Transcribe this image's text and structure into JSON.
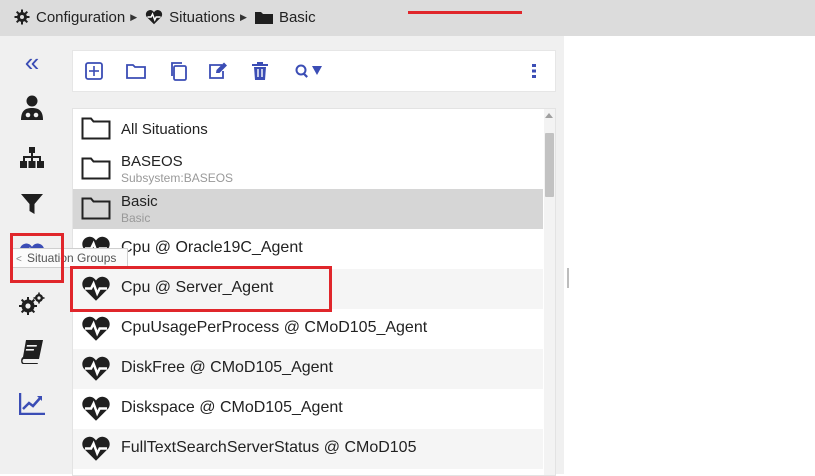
{
  "breadcrumb": {
    "items": [
      {
        "label": "Configuration",
        "icon": "gear-icon"
      },
      {
        "label": "Situations",
        "icon": "heartbeat-icon"
      },
      {
        "label": "Basic",
        "icon": "folder-icon"
      }
    ]
  },
  "nav": {
    "collapse_label": "«",
    "items": [
      {
        "icon": "user-agent-icon"
      },
      {
        "icon": "hierarchy-icon"
      },
      {
        "icon": "filter-icon"
      },
      {
        "icon": "heartbeat-icon",
        "selected": true
      },
      {
        "icon": "gears-icon"
      },
      {
        "icon": "book-icon"
      },
      {
        "icon": "chart-line-icon"
      }
    ],
    "tooltip": "Situation Groups"
  },
  "toolbar": {
    "buttons": [
      "add-square-icon",
      "new-folder-icon",
      "copy-icon",
      "edit-icon",
      "delete-icon",
      "search-icon",
      "more-vertical-icon"
    ]
  },
  "list": {
    "folders": [
      {
        "name": "All Situations",
        "subtitle": ""
      },
      {
        "name": "BASEOS",
        "subtitle": "Subsystem:BASEOS"
      },
      {
        "name": "Basic",
        "subtitle": "Basic",
        "selected": true
      }
    ],
    "situations": [
      "Cpu @ Oracle19C_Agent",
      "Cpu @ Server_Agent",
      "CpuUsagePerProcess @ CMoD105_Agent",
      "DiskFree @ CMoD105_Agent",
      "Diskspace @ CMoD105_Agent",
      "FullTextSearchServerStatus @ CMoD105"
    ]
  },
  "colors": {
    "accent": "#3b4db5",
    "icon_dark": "#1f1f1f",
    "highlight": "#e0262b",
    "selected_row": "#d6d6d6"
  }
}
